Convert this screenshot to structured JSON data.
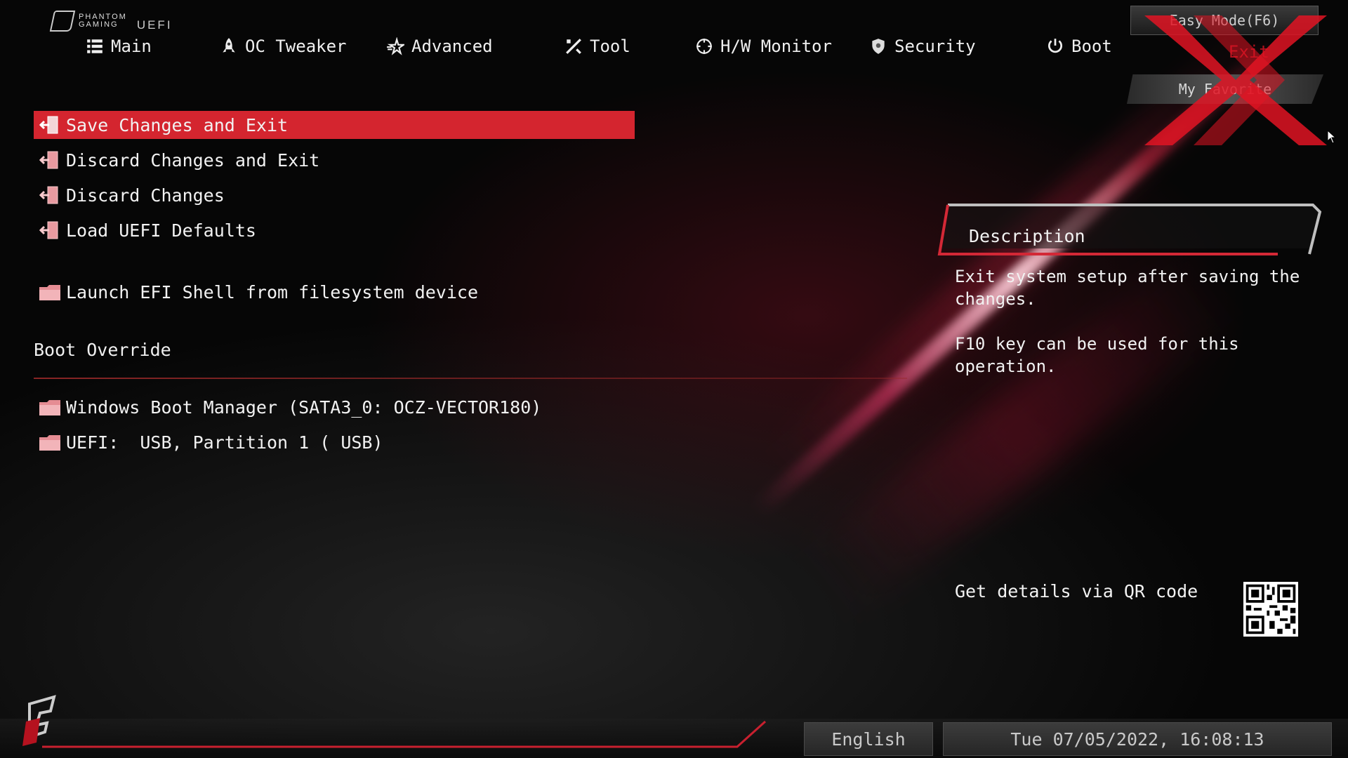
{
  "brand": {
    "line1": "PHANTOM",
    "line2": "GAMING",
    "uefi": "UEFI"
  },
  "nav": {
    "items": [
      {
        "label": "Main",
        "icon": "list-icon"
      },
      {
        "label": "OC Tweaker",
        "icon": "rocket-icon"
      },
      {
        "label": "Advanced",
        "icon": "star-icon"
      },
      {
        "label": "Tool",
        "icon": "tools-icon"
      },
      {
        "label": "H/W Monitor",
        "icon": "crosshair-icon"
      },
      {
        "label": "Security",
        "icon": "shield-icon"
      },
      {
        "label": "Boot",
        "icon": "power-icon"
      }
    ],
    "exit_label": "Exit",
    "easy_mode": "Easy Mode(F6)",
    "my_favorite": "My Favorite"
  },
  "menu": {
    "items": [
      {
        "label": "Save Changes and Exit",
        "selected": true,
        "icon": "exit-door-icon"
      },
      {
        "label": "Discard Changes and Exit",
        "selected": false,
        "icon": "exit-door-icon"
      },
      {
        "label": "Discard Changes",
        "selected": false,
        "icon": "exit-door-icon"
      },
      {
        "label": "Load UEFI Defaults",
        "selected": false,
        "icon": "exit-door-icon"
      },
      {
        "label": "Launch EFI Shell from filesystem device",
        "selected": false,
        "icon": "folder-icon"
      }
    ],
    "boot_override_title": "Boot Override",
    "boot_items": [
      {
        "label": "Windows Boot Manager (SATA3_0: OCZ-VECTOR180)",
        "icon": "folder-icon"
      },
      {
        "label": "UEFI:  USB, Partition 1 ( USB)",
        "icon": "folder-icon"
      }
    ]
  },
  "description": {
    "title": "Description",
    "text1": "Exit system setup after saving the changes.",
    "text2": "F10 key can be used for this operation.",
    "qr_label": "Get details via QR code"
  },
  "footer": {
    "language": "English",
    "datetime": "Tue 07/05/2022, 16:08:13"
  },
  "colors": {
    "accent": "#d4252f",
    "background": "#060606",
    "text": "#f2f2f2"
  }
}
